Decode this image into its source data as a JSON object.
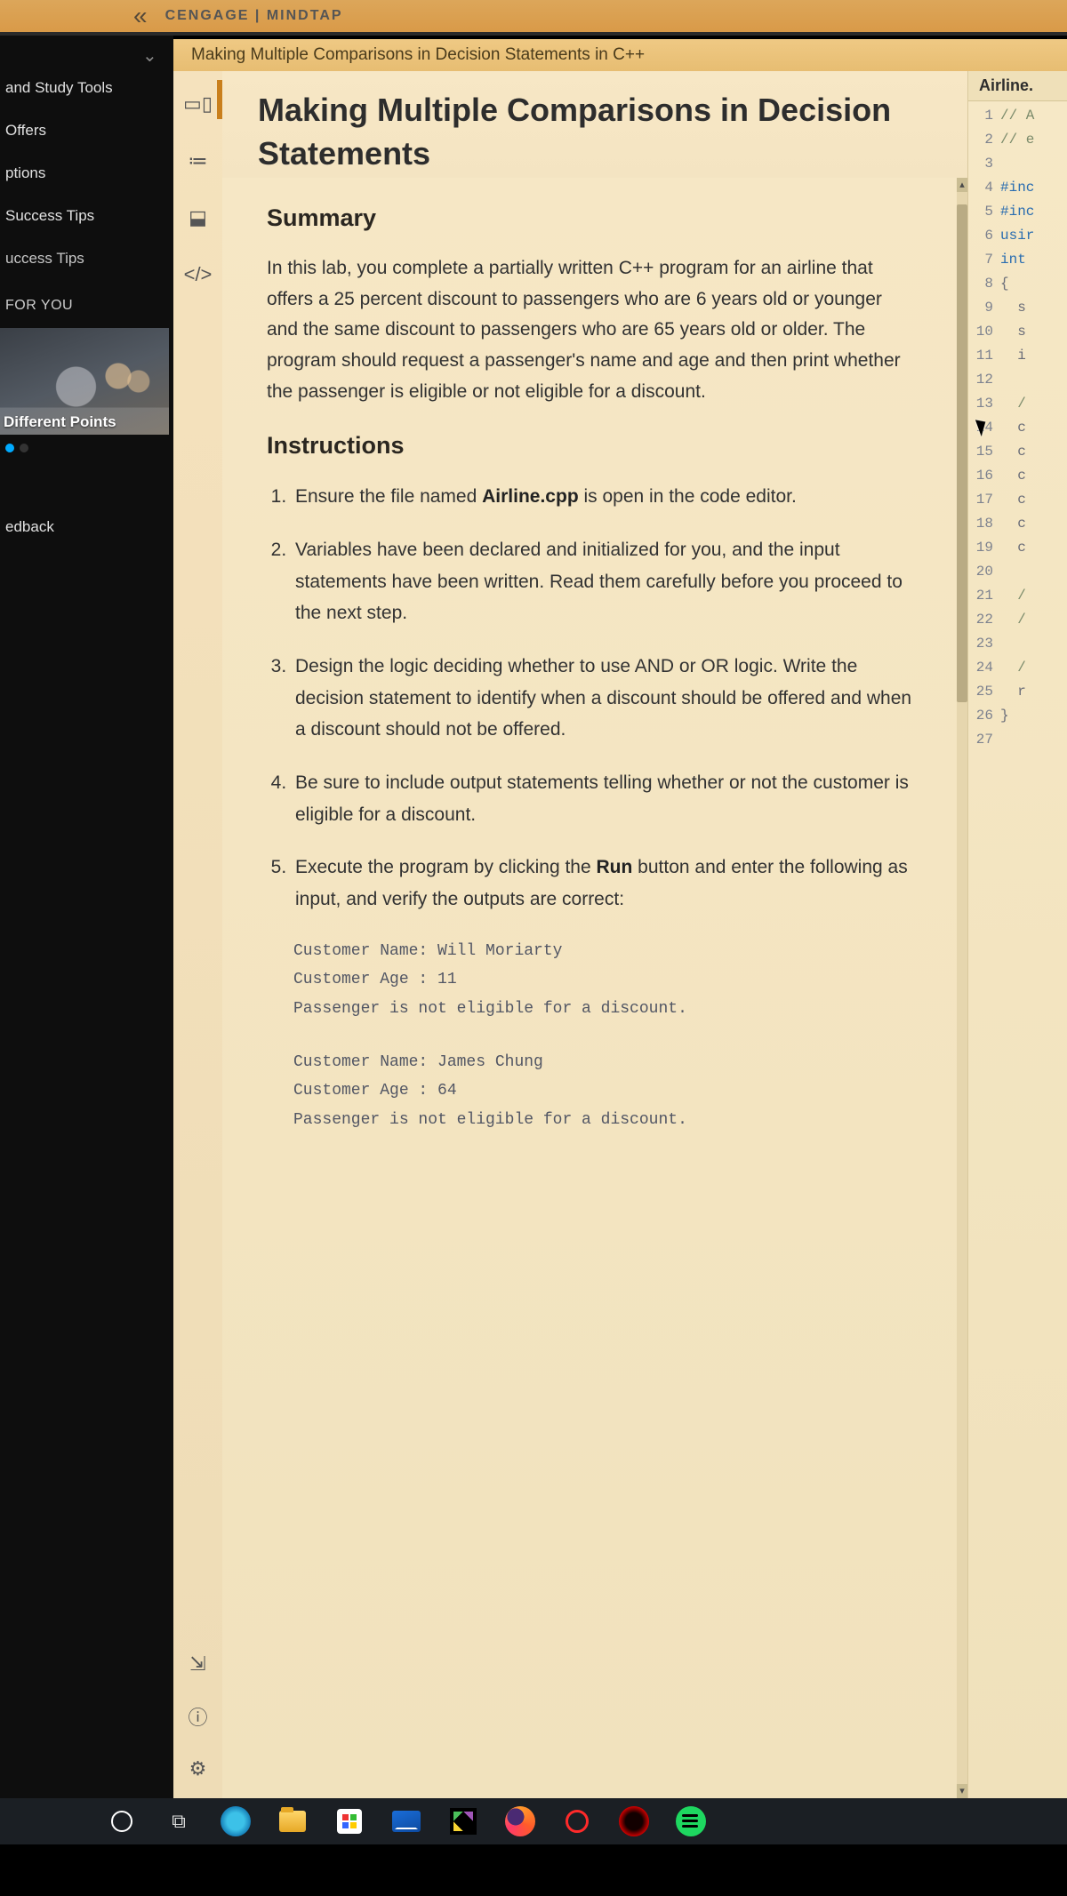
{
  "brand": "CENGAGE | MINDTAP",
  "breadcrumb": "Making Multiple Comparisons in Decision Statements in C++",
  "sidebar": {
    "items": [
      "and Study Tools",
      "Offers",
      "ptions",
      "Success Tips",
      "uccess Tips"
    ],
    "recommended_heading": "FOR YOU",
    "recommended_title": "Different Points",
    "feedback": "edback"
  },
  "rail": {
    "book": "📖",
    "toc": "☰",
    "stats": "📊",
    "code": "</>",
    "share": "↗",
    "help": "?",
    "settings": "⚙"
  },
  "page_title": "Making Multiple Comparisons in Decision Statements",
  "summary_heading": "Summary",
  "summary_body": "In this lab, you complete a partially written C++ program for an airline that offers a 25 percent discount to passengers who are 6 years old or younger and the same discount to passengers who are 65 years old or older. The program should request a passenger's name and age and then print whether the passenger is eligible or not eligible for a discount.",
  "instructions_heading": "Instructions",
  "steps": {
    "s1a": "Ensure the file named ",
    "s1b": "Airline.cpp",
    "s1c": " is open in the code editor.",
    "s2": "Variables have been declared and initialized for you, and the input statements have been written. Read them carefully before you proceed to the next step.",
    "s3": "Design the logic deciding whether to use AND or OR logic. Write the decision statement to identify when a discount should be offered and when a discount should not be offered.",
    "s4": "Be sure to include output statements telling whether or not the customer is eligible for a discount.",
    "s5a": "Execute the program by clicking the ",
    "s5b": "Run",
    "s5c": " button and enter the following as input, and verify the outputs are correct:"
  },
  "io_samples": {
    "block1": "Customer Name: Will Moriarty\nCustomer Age : 11\nPassenger is not eligible for a discount.",
    "block2": "Customer Name: James Chung\nCustomer Age : 64\nPassenger is not eligible for a discount."
  },
  "editor": {
    "tab_title": "Airline.",
    "lines": [
      {
        "n": 1,
        "txt": "// A",
        "cls": "cm"
      },
      {
        "n": 2,
        "txt": "// e",
        "cls": "cm"
      },
      {
        "n": 3,
        "txt": "",
        "cls": ""
      },
      {
        "n": 4,
        "txt": "#inc",
        "cls": "pp"
      },
      {
        "n": 5,
        "txt": "#inc",
        "cls": "pp"
      },
      {
        "n": 6,
        "txt": "usir",
        "cls": "kw"
      },
      {
        "n": 7,
        "txt": "int",
        "cls": "kw"
      },
      {
        "n": 8,
        "txt": "{",
        "cls": ""
      },
      {
        "n": 9,
        "txt": "  s",
        "cls": ""
      },
      {
        "n": 10,
        "txt": "  s",
        "cls": ""
      },
      {
        "n": 11,
        "txt": "  i",
        "cls": ""
      },
      {
        "n": 12,
        "txt": "",
        "cls": ""
      },
      {
        "n": 13,
        "txt": "  /",
        "cls": "cm"
      },
      {
        "n": 14,
        "txt": "  c",
        "cls": ""
      },
      {
        "n": 15,
        "txt": "  c",
        "cls": ""
      },
      {
        "n": 16,
        "txt": "  c",
        "cls": ""
      },
      {
        "n": 17,
        "txt": "  c",
        "cls": ""
      },
      {
        "n": 18,
        "txt": "  c",
        "cls": ""
      },
      {
        "n": 19,
        "txt": "  c",
        "cls": ""
      },
      {
        "n": 20,
        "txt": "",
        "cls": ""
      },
      {
        "n": 21,
        "txt": "  /",
        "cls": "cm"
      },
      {
        "n": 22,
        "txt": "  /",
        "cls": "cm"
      },
      {
        "n": 23,
        "txt": "",
        "cls": ""
      },
      {
        "n": 24,
        "txt": "  /",
        "cls": "cm"
      },
      {
        "n": 25,
        "txt": "  r",
        "cls": ""
      },
      {
        "n": 26,
        "txt": "}",
        "cls": ""
      },
      {
        "n": 27,
        "txt": "",
        "cls": ""
      }
    ]
  }
}
